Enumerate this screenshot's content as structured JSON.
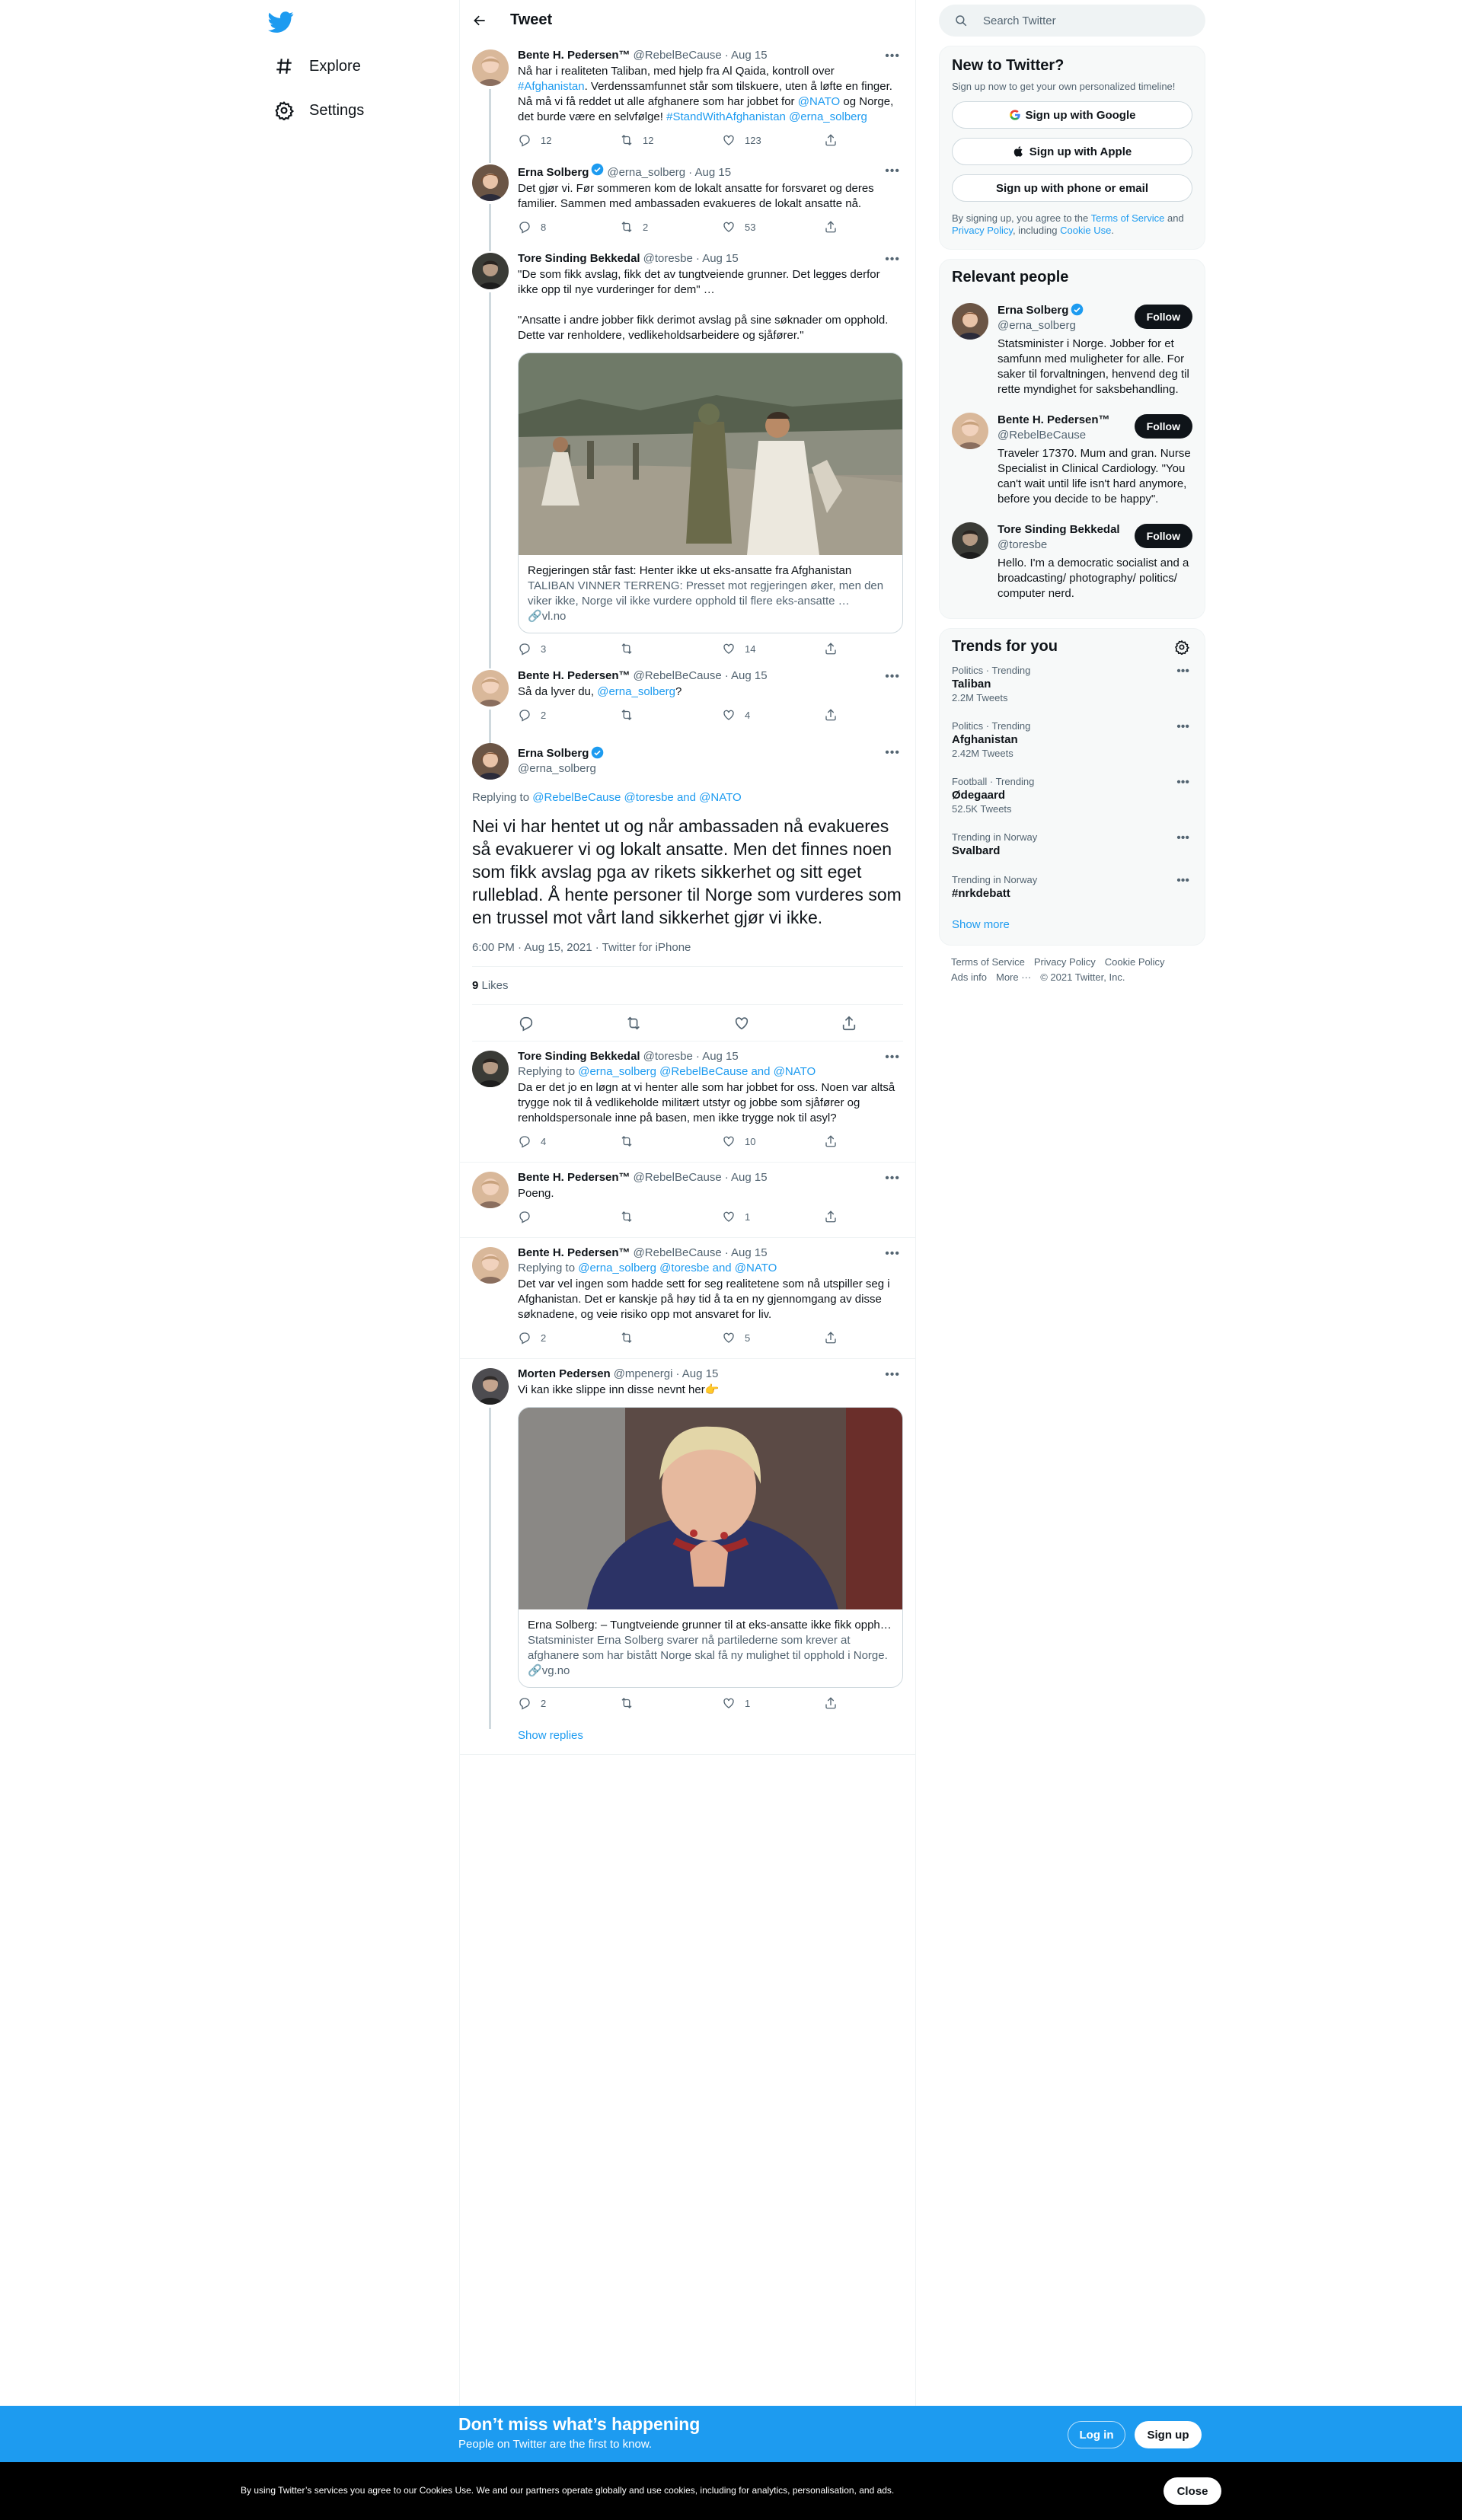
{
  "nav": {
    "explore": "Explore",
    "settings": "Settings"
  },
  "header": {
    "title": "Tweet"
  },
  "tweets_above": [
    {
      "name": "Bente H. Pedersen™",
      "handle": "@RebelBeCause",
      "date": "· Aug 15",
      "text_parts": [
        "Nå har i realiteten Taliban, med hjelp fra Al Qaida, kontroll over ",
        "#Afghanistan",
        ". Verdenssamfunnet står som tilskuere, uten å løfte en finger. Nå må vi få reddet ut alle afghanere som har jobbet for ",
        "@NATO",
        " og Norge, det burde være en selvfølge! ",
        "#StandWithAfghanistan",
        " ",
        "@erna_solberg"
      ],
      "replies": "12",
      "retweets": "12",
      "likes": "123"
    },
    {
      "name": "Erna Solberg",
      "handle": "@erna_solberg",
      "date": "· Aug 15",
      "text": "Det gjør vi. Før sommeren kom de lokalt ansatte for forsvaret og deres familier. Sammen med ambassaden evakueres de lokalt ansatte nå.",
      "replies": "8",
      "retweets": "2",
      "likes": "53"
    },
    {
      "name": "Tore Sinding Bekkedal",
      "handle": "@toresbe",
      "date": "· Aug 15",
      "text": "\"De som fikk avslag, fikk det av tungtveiende grunner. Det legges derfor ikke opp til nye vurderinger for dem\" …\n\n\"Ansatte i andre jobber fikk derimot avslag på sine søknader om opphold. Dette var renholdere, vedlikeholdsarbeidere og sjåfører.\"",
      "card": {
        "title": "Regjeringen står fast: Henter ikke ut eks-ansatte fra Afghanistan",
        "desc": "TALIBAN VINNER TERRENG: Presset mot regjeringen øker, men den viker ikke, Norge vil ikke vurdere opphold til flere eks-ansatte …",
        "domain": "vl.no"
      },
      "replies": "3",
      "retweets": "",
      "likes": "14"
    },
    {
      "name": "Bente H. Pedersen™",
      "handle": "@RebelBeCause",
      "date": "· Aug 15",
      "text_pre": "Så da lyver du, ",
      "text_mention": "@erna_solberg",
      "text_post": "?",
      "replies": "2",
      "retweets": "",
      "likes": "4"
    }
  ],
  "main_tweet": {
    "name": "Erna Solberg",
    "handle": "@erna_solberg",
    "replying_label": "Replying to ",
    "replying_to": "@RebelBeCause @toresbe and @NATO",
    "text": "Nei vi har hentet ut og når ambassaden nå evakueres så evakuerer vi og lokalt ansatte. Men det finnes noen som fikk avslag pga av rikets sikkerhet og sitt eget rulleblad.  Å hente personer til Norge som vurderes som en trussel mot vårt land sikkerhet gjør vi ikke.",
    "meta": "6:00 PM · Aug 15, 2021 · Twitter for iPhone",
    "likes_count": "9",
    "likes_label": " Likes"
  },
  "replies_below": [
    {
      "name": "Tore Sinding Bekkedal",
      "handle": "@toresbe",
      "date": "· Aug 15",
      "replying_to": "@erna_solberg @RebelBeCause and @NATO",
      "text": "Da er det jo en løgn at vi henter alle som har jobbet for oss. Noen var altså trygge nok til å vedlikeholde militært utstyr og jobbe som sjåfører og renholdspersonale inne på basen, men ikke trygge nok til asyl?",
      "replies": "4",
      "retweets": "",
      "likes": "10"
    },
    {
      "name": "Bente H. Pedersen™",
      "handle": "@RebelBeCause",
      "date": "· Aug 15",
      "text": "Poeng.",
      "replies": "",
      "retweets": "",
      "likes": "1"
    },
    {
      "name": "Bente H. Pedersen™",
      "handle": "@RebelBeCause",
      "date": "· Aug 15",
      "replying_to": "@erna_solberg @toresbe and @NATO",
      "text": "Det var vel ingen som hadde sett for seg realitetene som nå utspiller seg i Afghanistan. Det er kanskje på høy tid å ta en ny gjennomgang av disse søknadene, og veie risiko opp mot ansvaret for liv.",
      "replies": "2",
      "retweets": "",
      "likes": "5"
    },
    {
      "name": "Morten Pedersen",
      "handle": "@mpenergi",
      "date": "· Aug 15",
      "text": "Vi kan ikke slippe inn disse nevnt her👉",
      "card": {
        "title": "Erna Solberg: – Tungtveiende grunner til at eks-ansatte ikke fikk oppho…",
        "desc": "Statsminister Erna Solberg svarer nå partilederne som krever at afghanere som har bistått Norge skal få ny mulighet til opphold i Norge.",
        "domain": "vg.no"
      },
      "replies": "2",
      "retweets": "",
      "likes": "1"
    }
  ],
  "show_replies": "Show replies",
  "right": {
    "search_placeholder": "Search Twitter",
    "new_title": "New to Twitter?",
    "new_sub": "Sign up now to get your own personalized timeline!",
    "google": "Sign up with Google",
    "apple": "Sign up with Apple",
    "phone": "Sign up with phone or email",
    "legal_pre": "By signing up, you agree to the ",
    "tos": "Terms of Service",
    "legal_and": " and ",
    "privacy": "Privacy Policy",
    "legal_inc": ", including ",
    "cookie": "Cookie Use",
    "legal_end": ".",
    "relevant_title": "Relevant people",
    "follow": "Follow",
    "people": [
      {
        "name": "Erna Solberg",
        "handle": "@erna_solberg",
        "bio": "Statsminister i Norge. Jobber for et samfunn med muligheter for alle. For saker til forvaltningen, henvend deg til rette myndighet for saksbehandling."
      },
      {
        "name": "Bente H. Pedersen™",
        "handle": "@RebelBeCause",
        "bio": "Traveler 17370. Mum and gran. Nurse Specialist in Clinical Cardiology. \"You can't wait until life isn't hard anymore, before you decide to be happy\"."
      },
      {
        "name": "Tore Sinding Bekkedal",
        "handle": "@toresbe",
        "bio": "Hello. I'm a democratic socialist and a broadcasting/ photography/ politics/ computer nerd."
      }
    ],
    "trends_title": "Trends for you",
    "trends": [
      {
        "ctx": "Politics · Trending",
        "name": "Taliban",
        "count": "2.2M Tweets"
      },
      {
        "ctx": "Politics · Trending",
        "name": "Afghanistan",
        "count": "2.42M Tweets"
      },
      {
        "ctx": "Football · Trending",
        "name": "Ødegaard",
        "count": "52.5K Tweets"
      },
      {
        "ctx": "Trending in Norway",
        "name": "Svalbard",
        "count": ""
      },
      {
        "ctx": "Trending in Norway",
        "name": "#nrkdebatt",
        "count": ""
      }
    ],
    "show_more": "Show more",
    "footer": [
      "Terms of Service",
      "Privacy Policy",
      "Cookie Policy",
      "Ads info",
      "More ···",
      "© 2021 Twitter, Inc."
    ]
  },
  "bottom": {
    "title": "Don’t miss what’s happening",
    "sub": "People on Twitter are the first to know.",
    "login": "Log in",
    "signup": "Sign up",
    "cookie_text": "By using Twitter’s services you agree to our Cookies Use. We and our partners operate globally and use cookies, including for analytics, personalisation, and ads.",
    "close": "Close"
  },
  "colors": {
    "accent": "#1d9bf0",
    "text": "#0f1419",
    "secondary": "#536471"
  }
}
